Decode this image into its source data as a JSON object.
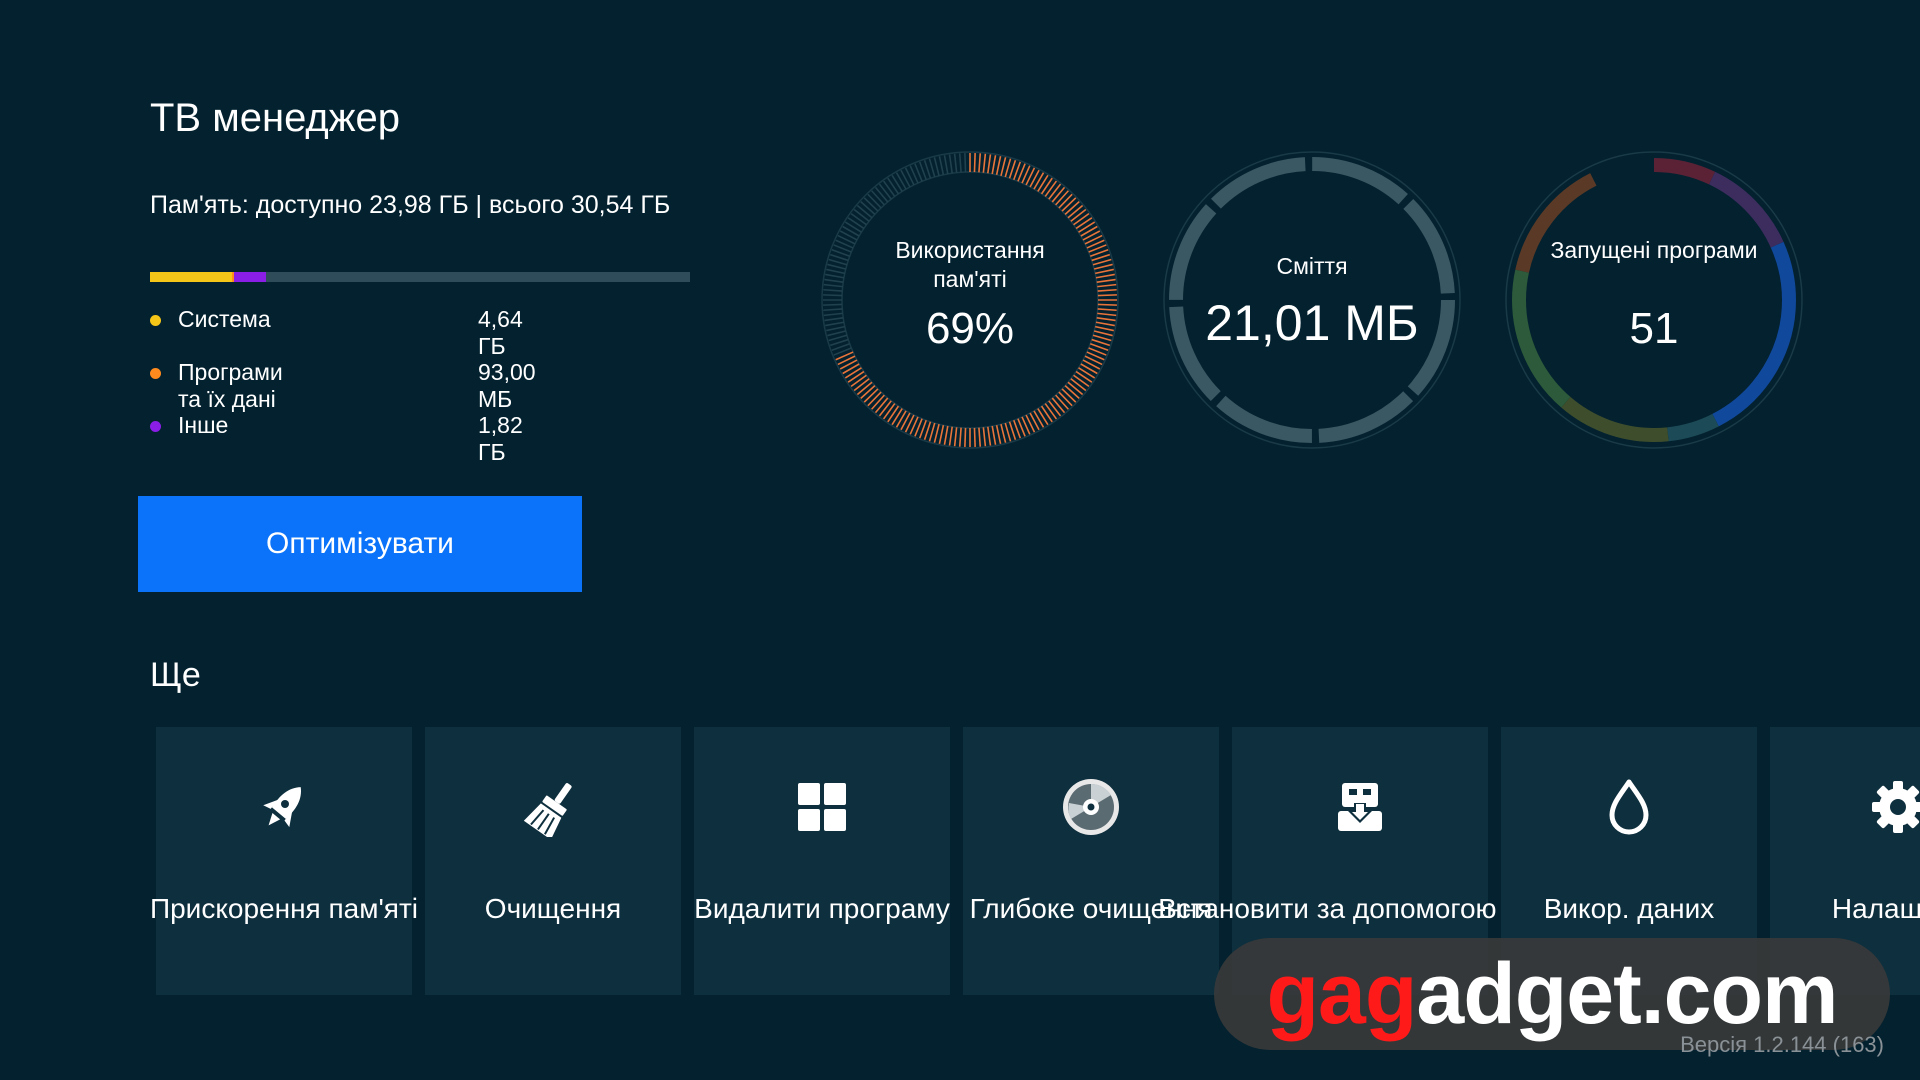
{
  "header": {
    "title": "ТВ менеджер"
  },
  "memory": {
    "summary": "Пам'ять: доступно 23,98 ГБ | всього 30,54 ГБ",
    "bar_segments": [
      {
        "name": "Система",
        "fraction": 0.152,
        "color": "#f5c518"
      },
      {
        "name": "Програми та їх дані",
        "fraction": 0.003,
        "color": "#ff8a1e"
      },
      {
        "name": "Інше",
        "fraction": 0.06,
        "color": "#8a1ee6"
      }
    ],
    "legend": [
      {
        "label": "Система",
        "value": "4,64 ГБ",
        "color": "#f5c518"
      },
      {
        "label": "Програми та їх дані",
        "value": "93,00 МБ",
        "color": "#ff8a1e"
      },
      {
        "label": "Інше",
        "value": "1,82 ГБ",
        "color": "#8a1ee6"
      }
    ]
  },
  "optimize_button": {
    "label": "Оптимізувати"
  },
  "gauges": [
    {
      "label": "Використання пам'яті",
      "value": "69%",
      "usage_fraction": 0.69,
      "accent": "#e8743a"
    },
    {
      "label": "Сміття",
      "value": "21,01 МБ",
      "accent": "#3e5b66"
    },
    {
      "label": "Запущені програми",
      "value": "51",
      "accent": "#1262c9"
    }
  ],
  "more_section": {
    "title": "Ще",
    "tiles": [
      {
        "label": "Прискорення пам'яті",
        "icon": "rocket-icon"
      },
      {
        "label": "Очищення",
        "icon": "broom-icon"
      },
      {
        "label": "Видалити програму",
        "icon": "apps-grid-icon"
      },
      {
        "label": "Глибоке очищення",
        "icon": "disc-icon"
      },
      {
        "label": "Встановити за допомогою USB",
        "icon": "usb-install-icon"
      },
      {
        "label": "Викор. даних",
        "icon": "water-drop-icon"
      },
      {
        "label": "Налаштув",
        "icon": "gear-icon"
      }
    ]
  },
  "watermark": {
    "red_part": "gag",
    "white_part": "adget.com"
  },
  "version": "Версія 1.2.144 (163)"
}
